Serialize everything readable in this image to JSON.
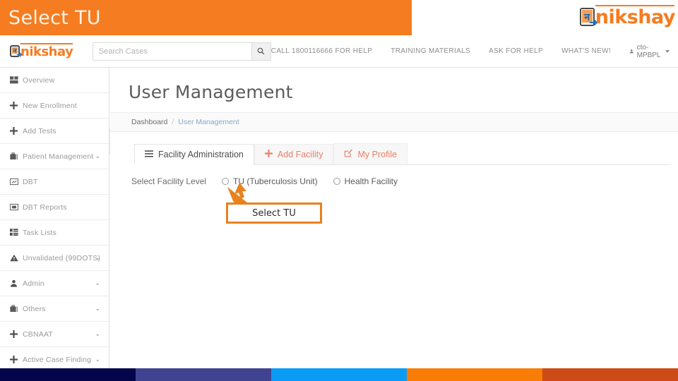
{
  "banner": {
    "title": "Select TU",
    "bg": "#F57C20"
  },
  "brand": {
    "name": "nikshay",
    "icon": "nikshay-phone-cursor-icon"
  },
  "navbar": {
    "search": {
      "placeholder": "Search Cases",
      "value": "",
      "icon": "search-icon"
    },
    "links": [
      "CALL 1800116666 FOR HELP",
      "TRAINING MATERIALS",
      "ASK FOR HELP",
      "WHAT'S NEW!"
    ],
    "user": {
      "name": "cto-MPBPL",
      "icon": "user-icon"
    }
  },
  "sidebar": {
    "collapse_icon": "chevron-left-icon",
    "items": [
      {
        "label": "Overview",
        "icon": "dashboard-icon",
        "caret": ""
      },
      {
        "label": "New Enrollment",
        "icon": "plus-icon",
        "caret": ""
      },
      {
        "label": "Add Tests",
        "icon": "plus-icon",
        "caret": ""
      },
      {
        "label": "Patient Management",
        "icon": "briefcase-icon",
        "caret": "⌄"
      },
      {
        "label": "DBT",
        "icon": "chart-icon",
        "caret": ""
      },
      {
        "label": "DBT Reports",
        "icon": "report-icon",
        "caret": ""
      },
      {
        "label": "Task Lists",
        "icon": "grid-icon",
        "caret": ""
      },
      {
        "label": "Unvalidated (99DOTS)",
        "icon": "warning-icon",
        "caret": "⌄"
      },
      {
        "label": "Admin",
        "icon": "person-icon",
        "caret": "⌄"
      },
      {
        "label": "Others",
        "icon": "briefcase-icon",
        "caret": "⌄"
      },
      {
        "label": "CBNAAT",
        "icon": "plus-icon",
        "caret": "⌄"
      },
      {
        "label": "Active Case Finding",
        "icon": "plus-icon",
        "caret": "⌄"
      }
    ]
  },
  "main": {
    "page_title": "User Management",
    "breadcrumb": {
      "root": "Dashboard",
      "separator": "/",
      "current": "User Management"
    },
    "tabs": [
      {
        "label": "Facility Administration",
        "icon": "list-icon",
        "active": true
      },
      {
        "label": "Add Facility",
        "icon": "plus-icon",
        "active": false
      },
      {
        "label": "My Profile",
        "icon": "edit-icon",
        "active": false
      }
    ],
    "facility_level": {
      "label": "Select Facility Level",
      "options": [
        {
          "label": "TU (Tuberculosis Unit)",
          "selected": false
        },
        {
          "label": "Health Facility",
          "selected": false
        }
      ]
    }
  },
  "annotation": {
    "callout_text": "Select TU",
    "border_color": "#E8821E",
    "arrow_color": "#E8821E"
  },
  "colorbar": {
    "segments": [
      "#04054a",
      "#404391",
      "#0a9cf5",
      "#f97c07",
      "#cc4b16"
    ]
  }
}
